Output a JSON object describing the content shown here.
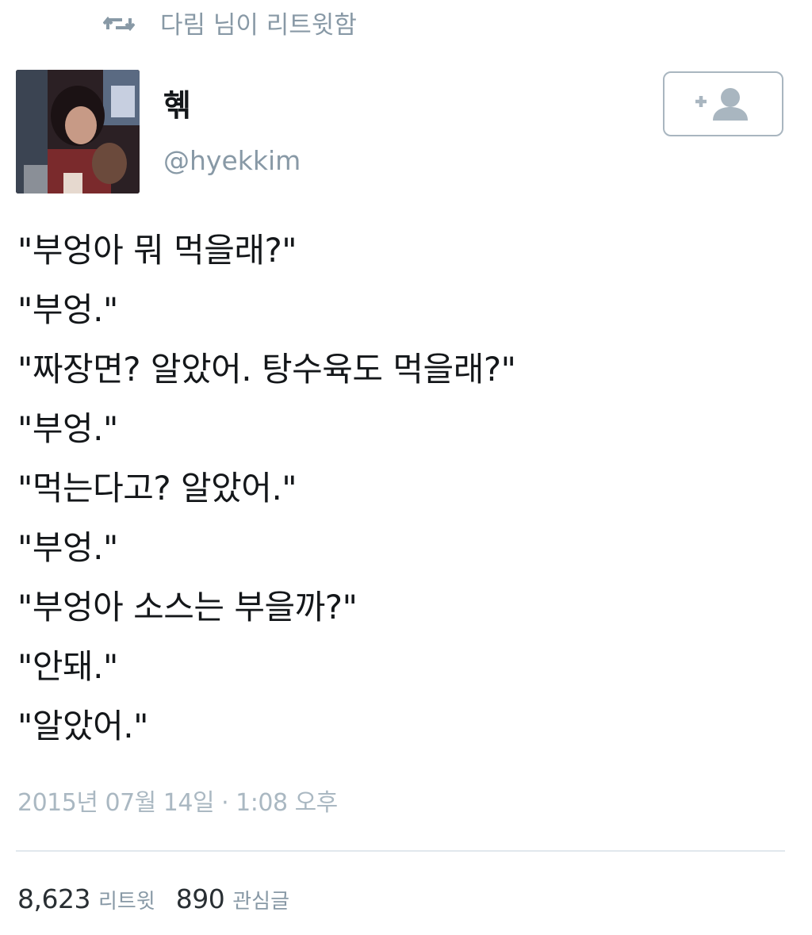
{
  "retweet_context": {
    "icon": "retweet-icon",
    "text": "다림 님이 리트윗함"
  },
  "author": {
    "name": "혞",
    "handle": "@hyekkim",
    "avatar_icon": "profile-photo"
  },
  "follow_button": {
    "icon": "add-user-icon",
    "color": "#a9b6c0"
  },
  "tweet": {
    "lines": [
      "\"부엉아 뭐 먹을래?\"",
      "\"부엉.\"",
      "\"짜장면? 알았어. 탕수육도 먹을래?\"",
      "\"부엉.\"",
      "\"먹는다고? 알았어.\"",
      "\"부엉.\"",
      "\"부엉아 소스는 부을까?\"",
      "\"안돼.\"",
      "\"알았어.\""
    ],
    "timestamp": "2015년 07월 14일 · 1:08 오후"
  },
  "stats": {
    "retweets_count": "8,623",
    "retweets_label": "리트윗",
    "likes_count": "890",
    "likes_label": "관심글"
  },
  "colors": {
    "text": "#14171a",
    "muted": "#8899a6",
    "timestamp": "#aab8c2",
    "divider": "#e1e8ed"
  }
}
